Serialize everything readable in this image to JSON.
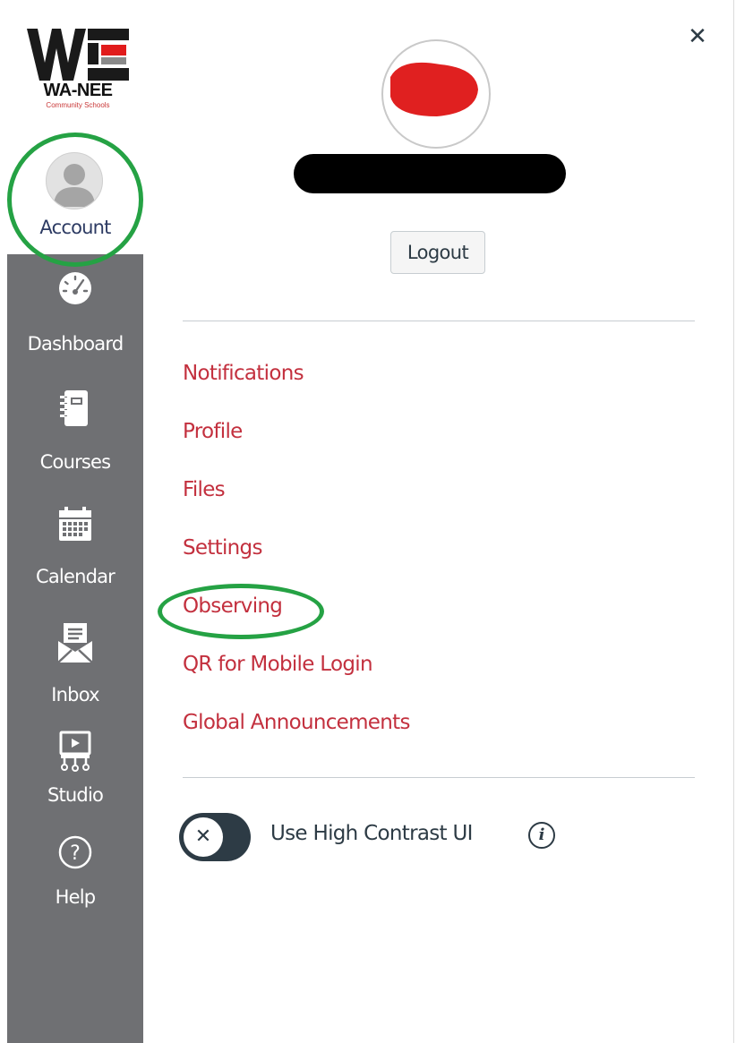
{
  "logo": {
    "name": "WA-NEE",
    "subtitle": "Community Schools"
  },
  "nav": {
    "items": [
      {
        "label": "Account",
        "icon": "user-avatar-icon"
      },
      {
        "label": "Dashboard",
        "icon": "dashboard-gauge-icon"
      },
      {
        "label": "Courses",
        "icon": "courses-notebook-icon"
      },
      {
        "label": "Calendar",
        "icon": "calendar-icon"
      },
      {
        "label": "Inbox",
        "icon": "inbox-envelope-icon"
      },
      {
        "label": "Studio",
        "icon": "studio-screen-icon"
      },
      {
        "label": "Help",
        "icon": "help-question-icon"
      }
    ]
  },
  "tray": {
    "close_symbol": "✕",
    "logout_label": "Logout",
    "links": [
      "Notifications",
      "Profile",
      "Files",
      "Settings",
      "Observing",
      "QR for Mobile Login",
      "Global Announcements"
    ],
    "high_contrast_label": "Use High Contrast UI",
    "high_contrast_on": false,
    "toggle_symbol": "✕",
    "info_symbol": "i"
  },
  "colors": {
    "nav_background": "#6f7073",
    "link_red": "#c3303e",
    "text_dark": "#2d3b45",
    "annotation_green": "#25a244",
    "redaction_red": "#e02020",
    "redaction_black": "#000000"
  }
}
